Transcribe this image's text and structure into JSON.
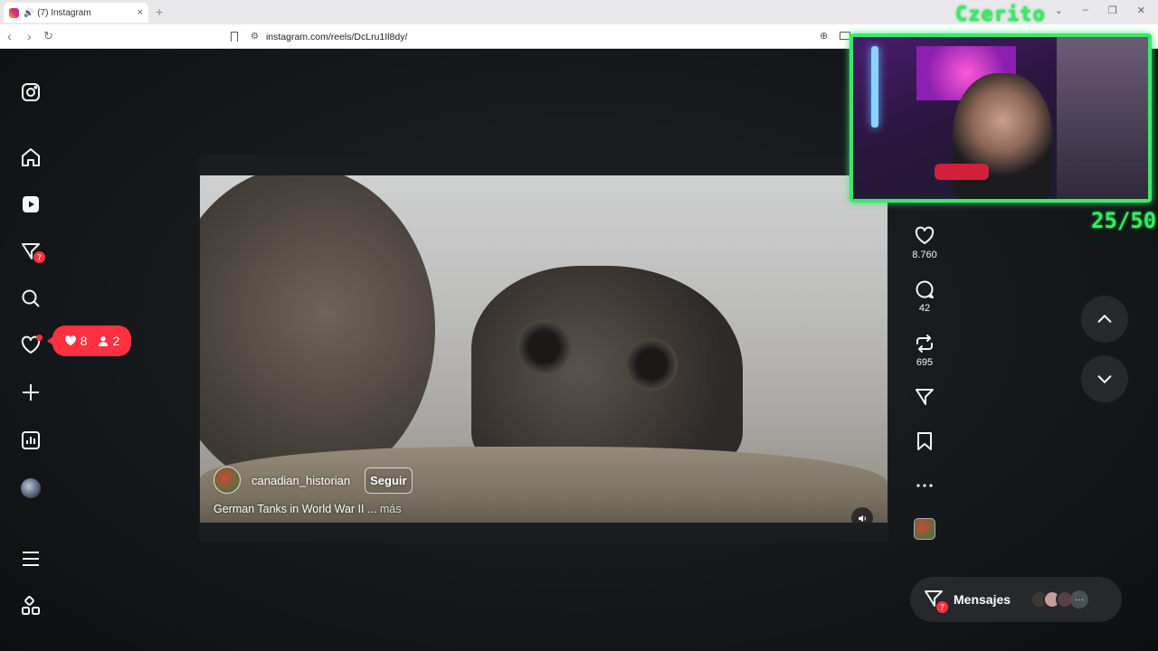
{
  "browser": {
    "tab_title": "(7) Instagram",
    "tab_close": "×",
    "new_tab": "+",
    "url": "instagram.com/reels/DcLru1Il8dy/",
    "window_controls": [
      "⌄",
      "–",
      "❐",
      "✕"
    ]
  },
  "sidebar": {
    "items": [
      {
        "name": "instagram-logo-icon"
      },
      {
        "name": "home-icon"
      },
      {
        "name": "reels-icon"
      },
      {
        "name": "messages-icon",
        "badge": "7"
      },
      {
        "name": "search-icon"
      },
      {
        "name": "notifications-icon",
        "dot": true
      },
      {
        "name": "create-icon"
      },
      {
        "name": "dashboard-icon"
      },
      {
        "name": "profile-avatar"
      },
      {
        "name": "menu-icon"
      },
      {
        "name": "more-apps-icon"
      }
    ]
  },
  "notification_bubble": {
    "likes": "8",
    "followers": "2"
  },
  "reel": {
    "username": "canadian_historian",
    "follow_label": "Seguir",
    "caption": "German Tanks in World War II ...",
    "more_label": " más"
  },
  "actions": {
    "likes": "8.760",
    "comments": "42",
    "reposts": "695"
  },
  "messages": {
    "label": "Mensajes",
    "badge": "7",
    "more": "···"
  },
  "overlay": {
    "streamer_name": "Czerito",
    "counter": "25/50"
  },
  "colors": {
    "accent_red": "#ff3040",
    "overlay_green": "#3ce86b",
    "page_bg": "#15181a"
  }
}
